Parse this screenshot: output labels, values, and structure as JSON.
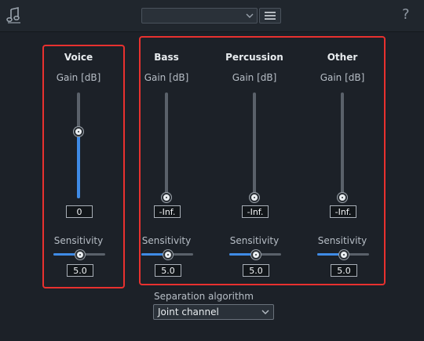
{
  "toolbar": {
    "logo_icon": "music-note-icon",
    "preset_value": "",
    "menu_icon": "hamburger-menu-icon",
    "help_label": "?"
  },
  "voice": {
    "title": "Voice",
    "gain_label": "Gain [dB]",
    "gain_value": "0",
    "gain_level": 0.62,
    "sensitivity_label": "Sensitivity",
    "sensitivity_value": "5.0",
    "sensitivity_level": 0.5
  },
  "stems": [
    {
      "title": "Bass",
      "gain_label": "Gain [dB]",
      "gain_value": "-Inf.",
      "gain_level": 0.0,
      "sensitivity_label": "Sensitivity",
      "sensitivity_value": "5.0",
      "sensitivity_level": 0.5
    },
    {
      "title": "Percussion",
      "gain_label": "Gain [dB]",
      "gain_value": "-Inf.",
      "gain_level": 0.0,
      "sensitivity_label": "Sensitivity",
      "sensitivity_value": "5.0",
      "sensitivity_level": 0.5
    },
    {
      "title": "Other",
      "gain_label": "Gain [dB]",
      "gain_value": "-Inf.",
      "gain_level": 0.0,
      "sensitivity_label": "Sensitivity",
      "sensitivity_value": "5.0",
      "sensitivity_level": 0.5
    }
  ],
  "separation": {
    "label": "Separation algorithm",
    "value": "Joint channel"
  },
  "colors": {
    "accent": "#3f8be6",
    "highlight": "#e8312f",
    "background": "#1c2128"
  }
}
